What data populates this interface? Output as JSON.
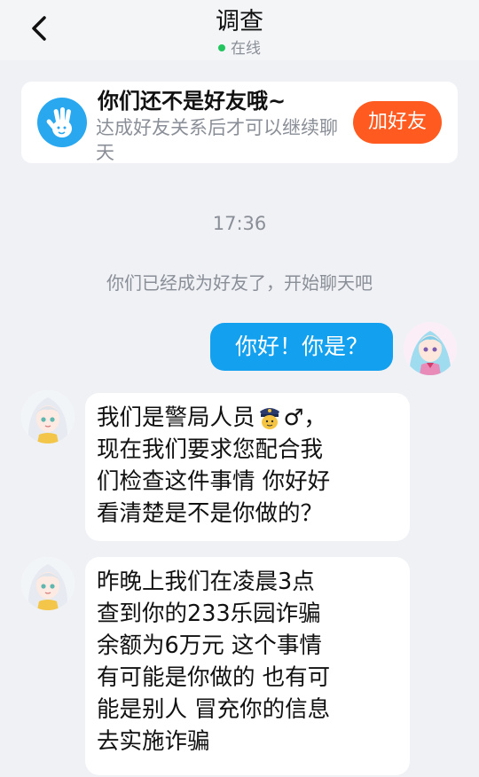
{
  "header": {
    "title": "调查",
    "status": "在线"
  },
  "friend_card": {
    "title": "你们还不是好友哦~",
    "subtitle": "达成好友关系后才可以继续聊天",
    "button_label": "加好友"
  },
  "chat": {
    "timestamp": "17:36",
    "system_message": "你们已经成为好友了，开始聊天吧",
    "messages": [
      {
        "sender": "me",
        "text": "你好！你是？"
      },
      {
        "sender": "other",
        "lines": [
          "我们是警局人员",
          "♂，",
          "现在我们要求您配合我",
          "们检查这件事情 你好好",
          "看清楚是不是你做的？"
        ]
      },
      {
        "sender": "other",
        "lines": [
          "昨晚上我们在凌晨3点",
          "查到你的233乐园诈骗",
          "余额为6万元 这个事情",
          "有可能是你做的 也有可",
          "能是别人 冒充你的信息",
          "去实施诈骗"
        ]
      }
    ]
  },
  "icons": {
    "back": "chevron-left-icon",
    "wave": "waving-hand-icon",
    "police": "police-officer-emoji"
  },
  "colors": {
    "accent_blue": "#13a0ee",
    "add_friend_orange": "#ff5a1f",
    "online_green": "#22c55e",
    "background": "#eff1f5"
  }
}
